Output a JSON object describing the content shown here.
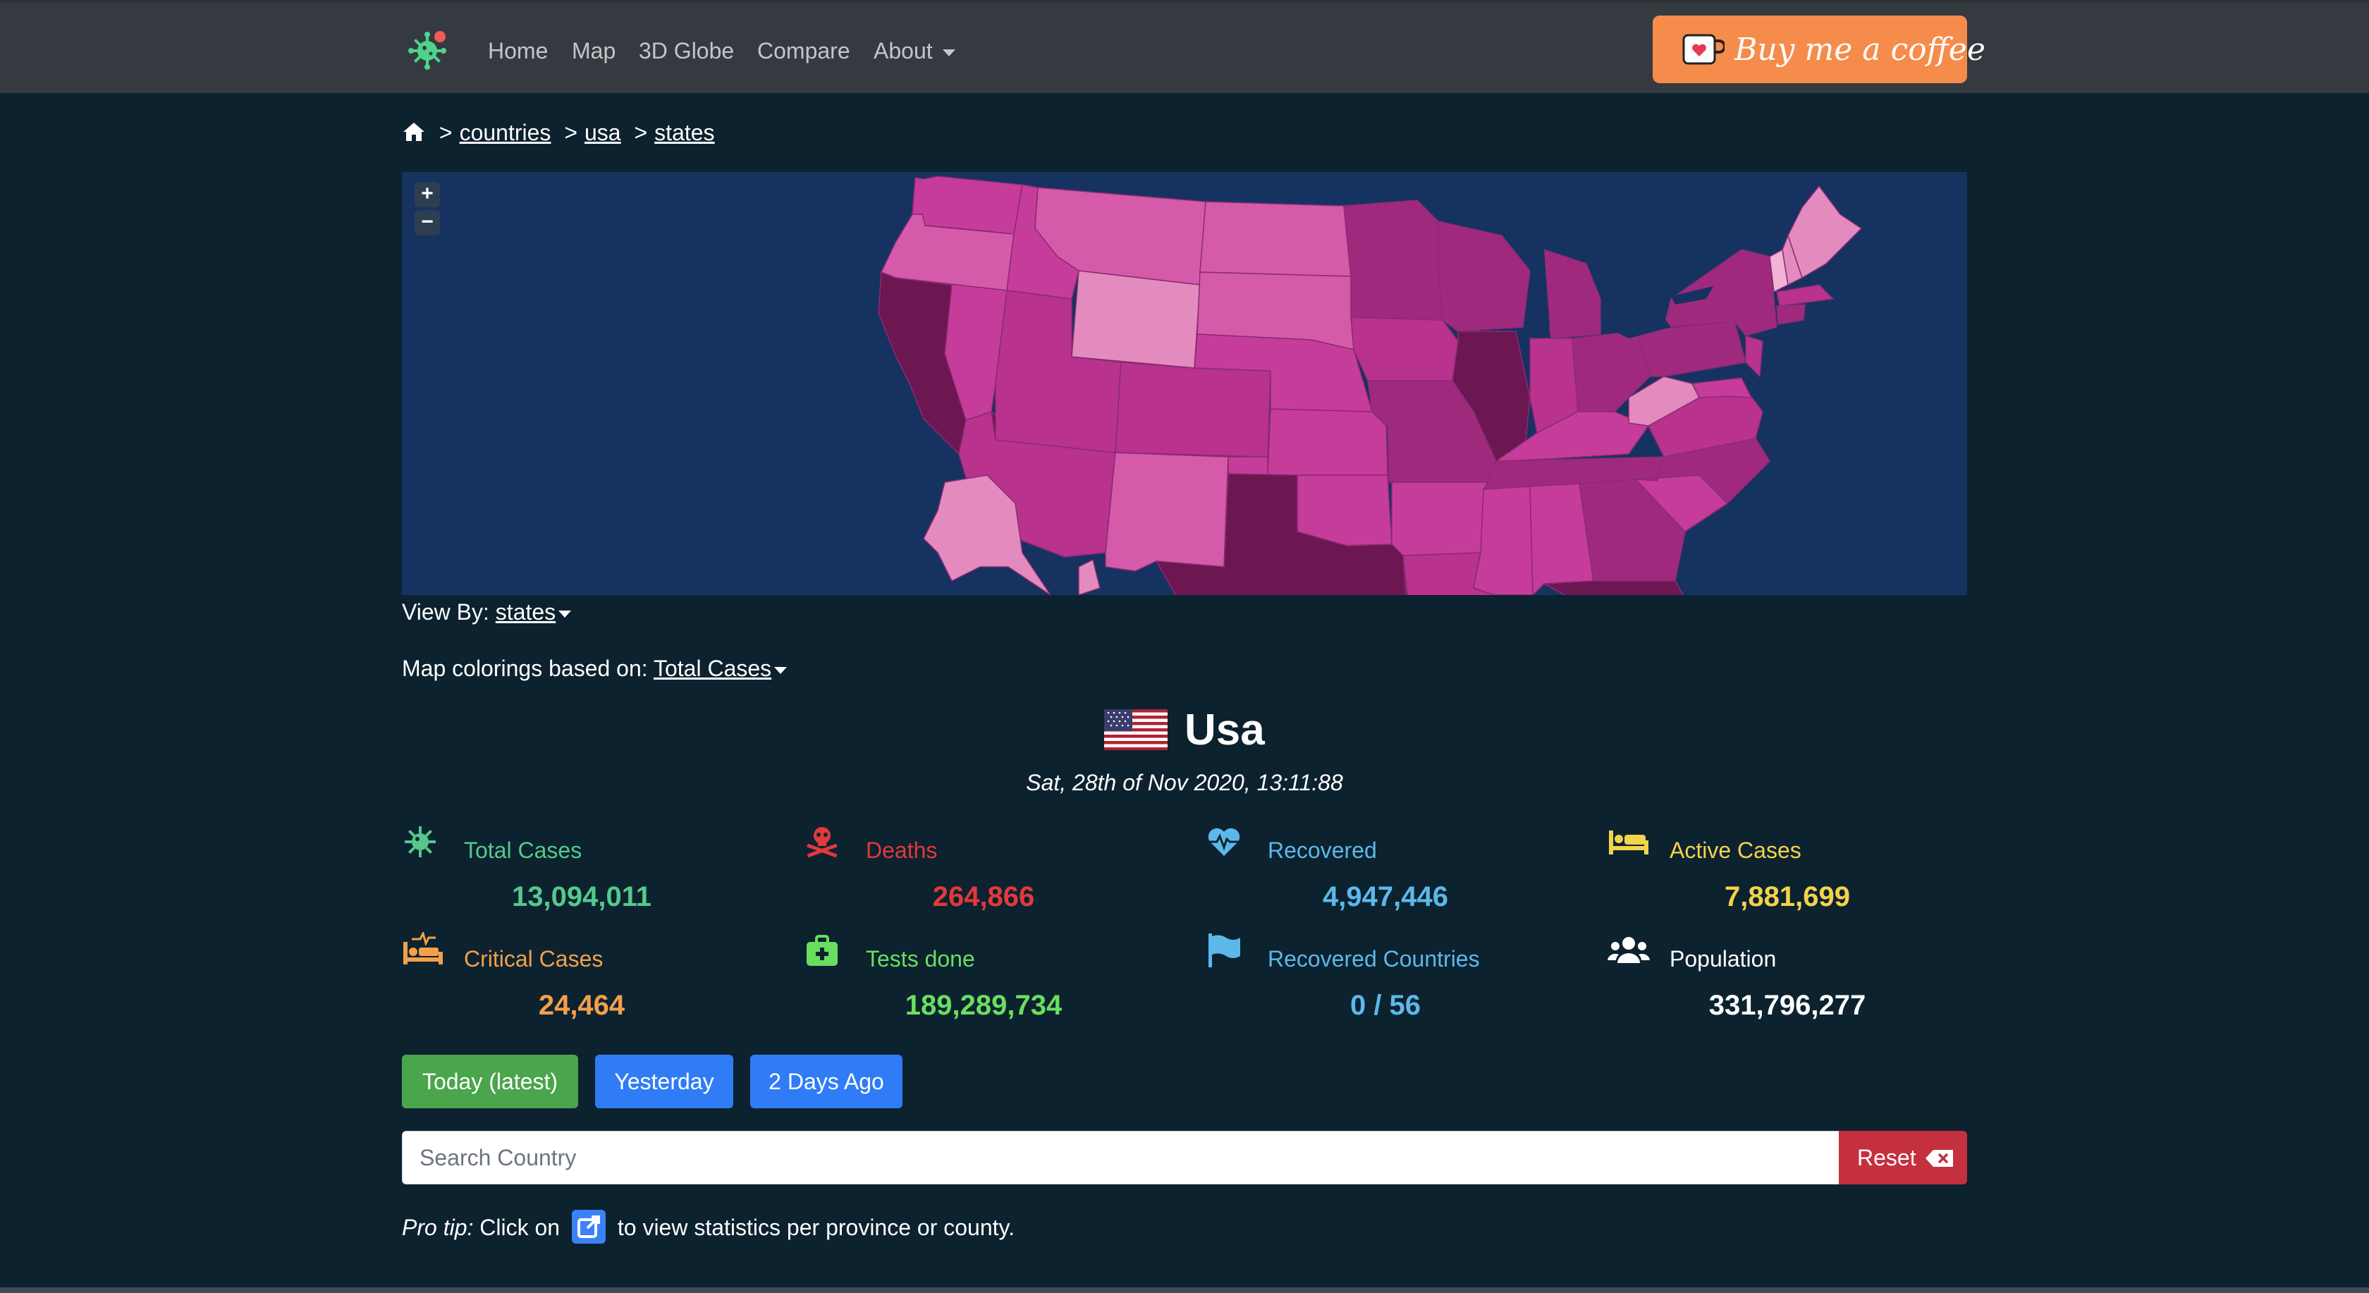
{
  "nav": {
    "links": [
      "Home",
      "Map",
      "3D Globe",
      "Compare",
      "About"
    ],
    "coffee_label": "Buy me a coffee"
  },
  "breadcrumb": {
    "items": [
      "countries",
      "usa",
      "states"
    ],
    "separator": ">"
  },
  "map": {
    "zoom_in": "+",
    "zoom_out": "−",
    "ocean_color": "#163261"
  },
  "controls": {
    "view_by_label": "View By:",
    "view_by_value": "states",
    "coloring_label": "Map colorings based on:",
    "coloring_value": "Total Cases"
  },
  "country": {
    "name": "Usa",
    "timestamp": "Sat, 28th of Nov 2020, 13:11:88"
  },
  "stats": [
    {
      "label": "Total Cases",
      "value": "13,094,011",
      "color": "#55c98a",
      "icon": "virus-icon"
    },
    {
      "label": "Deaths",
      "value": "264,866",
      "color": "#e2393b",
      "icon": "skull-crossbones-icon"
    },
    {
      "label": "Recovered",
      "value": "4,947,446",
      "color": "#5cb8ea",
      "icon": "heartbeat-icon"
    },
    {
      "label": "Active Cases",
      "value": "7,881,699",
      "color": "#f3d34a",
      "icon": "bed-icon"
    },
    {
      "label": "Critical Cases",
      "value": "24,464",
      "color": "#f3a04b",
      "icon": "procedures-icon"
    },
    {
      "label": "Tests done",
      "value": "189,289,734",
      "color": "#6ade5f",
      "icon": "medkit-icon"
    },
    {
      "label": "Recovered Countries",
      "value": "0 / 56",
      "color": "#5cb8ea",
      "icon": "flag-icon"
    },
    {
      "label": "Population",
      "value": "331,796,277",
      "color": "#ffffff",
      "icon": "users-icon"
    }
  ],
  "date_buttons": [
    {
      "label": "Today (latest)",
      "color": "#4aa54d"
    },
    {
      "label": "Yesterday",
      "color": "#2f7cf6"
    },
    {
      "label": "2 Days Ago",
      "color": "#2f7cf6"
    }
  ],
  "search": {
    "placeholder": "Search Country",
    "reset_label": "Reset"
  },
  "pro_tip": {
    "prefix": "Pro tip:",
    "before_icon": "Click on",
    "after_icon": "to view statistics per province or county."
  }
}
